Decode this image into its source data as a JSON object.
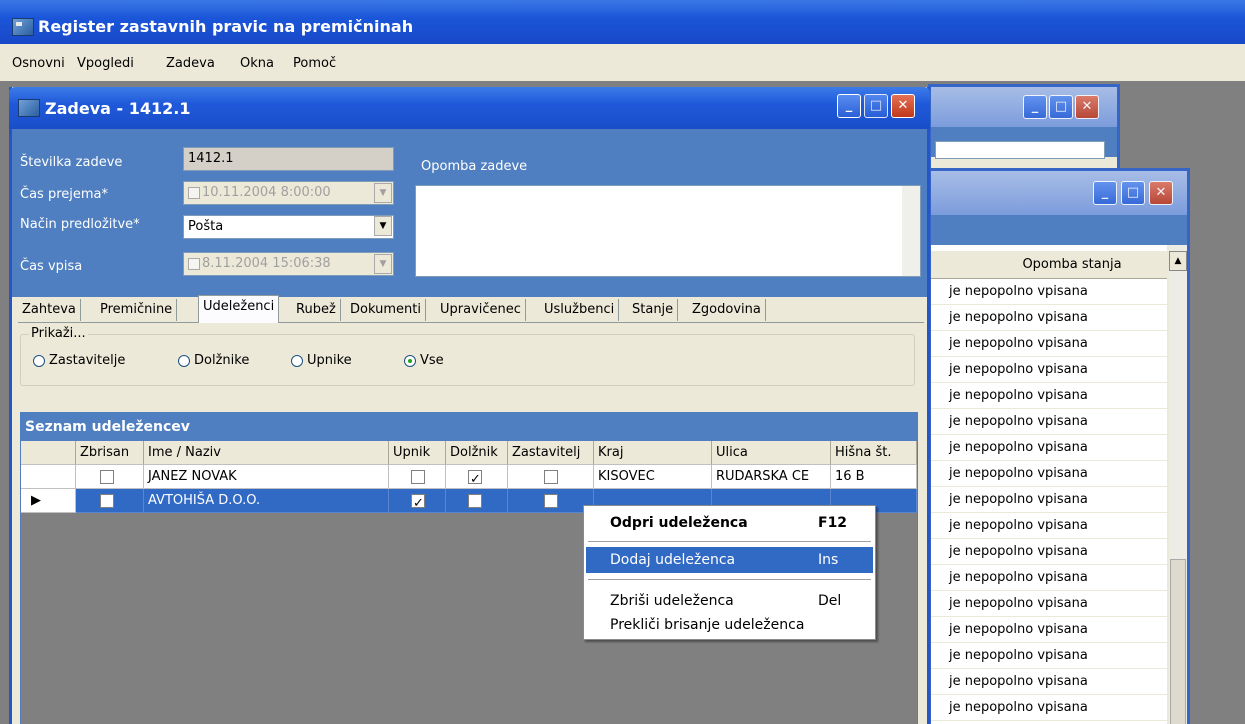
{
  "app": {
    "title": "Register zastavnih pravic na premičninah"
  },
  "menu": [
    "Osnovni",
    "Vpogledi",
    "Zadeva",
    "Okna",
    "Pomoč"
  ],
  "window": {
    "title": "Zadeva - 1412.1",
    "fields": {
      "stevilka_label": "Številka zadeve",
      "stevilka_value": "1412.1",
      "cas_prejema_label": "Čas prejema*",
      "cas_prejema_value": "10.11.2004  8:00:00",
      "nacin_label": "Način predložitve*",
      "nacin_value": "Pošta",
      "cas_vpisa_label": "Čas vpisa",
      "cas_vpisa_value": "8.11.2004 15:06:38",
      "opomba_label": "Opomba zadeve"
    },
    "tabs": [
      "Zahteva",
      "Premičnine",
      "Udeleženci",
      "Rubež",
      "Dokumenti",
      "Upravičenec",
      "Uslužbenci",
      "Stanje",
      "Zgodovina"
    ],
    "active_tab": "Udeleženci",
    "filter": {
      "legend": "Prikaži...",
      "options": [
        "Zastavitelje",
        "Dolžnike",
        "Upnike",
        "Vse"
      ],
      "selected": "Vse"
    },
    "list": {
      "title": "Seznam udeležencev",
      "columns": [
        "Zbrisan",
        "Ime / Naziv",
        "Upnik",
        "Dolžnik",
        "Zastavitelj",
        "Kraj",
        "Ulica",
        "Hišna št."
      ],
      "rows": [
        {
          "zbrisan": false,
          "ime": "JANEZ NOVAK",
          "upnik": false,
          "dolznik": true,
          "zastavitelj": false,
          "kraj": "KISOVEC",
          "ulica": "RUDARSKA CE",
          "hisna": "16 B",
          "selected": false
        },
        {
          "zbrisan": false,
          "ime": "AVTOHIŠA D.O.O.",
          "upnik": true,
          "dolznik": false,
          "zastavitelj": false,
          "kraj": "",
          "ulica": "",
          "hisna": "",
          "selected": true
        }
      ]
    }
  },
  "context_menu": {
    "items": [
      {
        "label": "Odpri udeleženca",
        "shortcut": "F12",
        "bold": true
      },
      {
        "label": "Dodaj udeleženca",
        "shortcut": "Ins",
        "highlighted": true
      },
      {
        "label": "Zbriši udeleženca",
        "shortcut": "Del"
      },
      {
        "label": "Prekliči brisanje udeleženca",
        "shortcut": ""
      }
    ]
  },
  "back_window": {
    "column": "Opomba stanja",
    "rows": [
      "je nepopolno vpisana",
      "je nepopolno vpisana",
      "je nepopolno vpisana",
      "je nepopolno vpisana",
      "je nepopolno vpisana",
      "je nepopolno vpisana",
      "je nepopolno vpisana",
      "je nepopolno vpisana",
      "je nepopolno vpisana",
      "je nepopolno vpisana",
      "je nepopolno vpisana",
      "je nepopolno vpisana",
      "je nepopolno vpisana",
      "je nepopolno vpisana",
      "je nepopolno vpisana",
      "je nepopolno vpisana",
      "je nepopolno vpisana"
    ]
  }
}
